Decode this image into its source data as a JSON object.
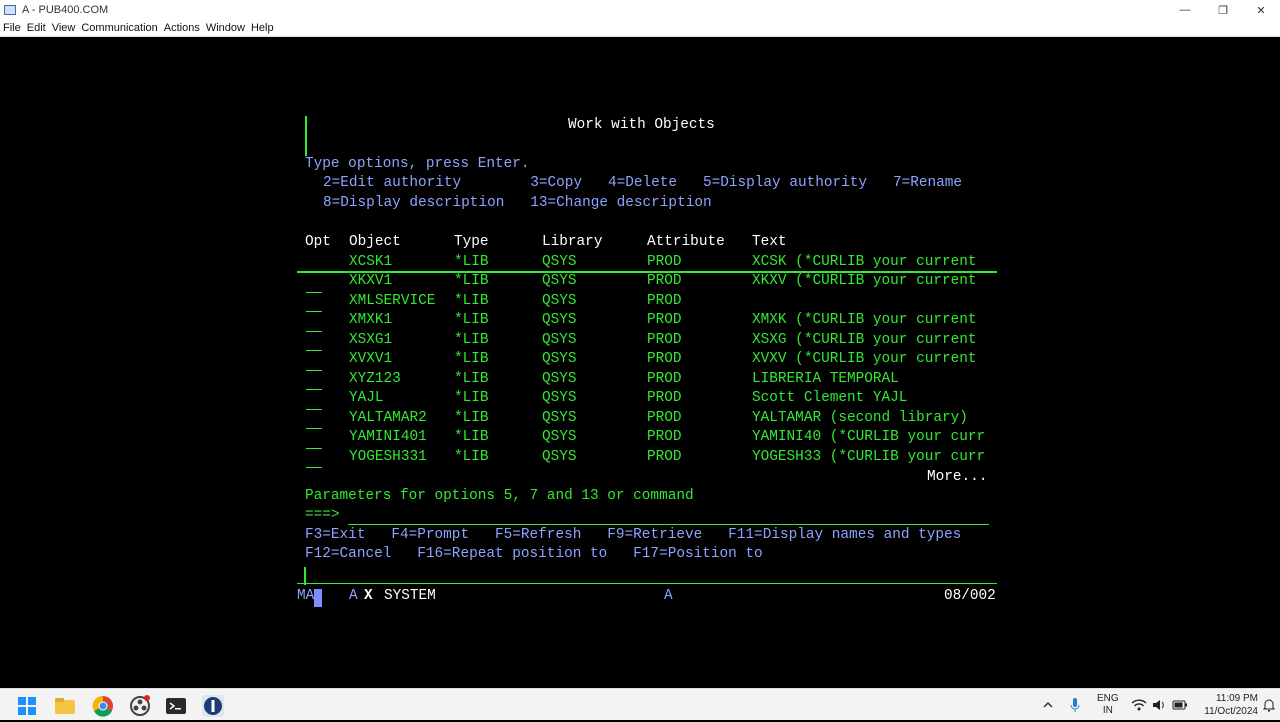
{
  "window": {
    "title": "A - PUB400.COM",
    "controls": [
      "—",
      "❐",
      "✕"
    ]
  },
  "menu": [
    "File",
    "Edit",
    "View",
    "Communication",
    "Actions",
    "Window",
    "Help"
  ],
  "screen": {
    "title": "Work with Objects",
    "instruction": "Type options, press Enter.",
    "options_line1": "2=Edit authority        3=Copy   4=Delete   5=Display authority   7=Rename",
    "options_line2": "8=Display description   13=Change description",
    "headers": {
      "opt": "Opt",
      "object": "Object",
      "type": "Type",
      "library": "Library",
      "attribute": "Attribute",
      "text": "Text"
    },
    "rows": [
      {
        "object": "XCSK1",
        "type": "*LIB",
        "library": "QSYS",
        "attribute": "PROD",
        "text": "XCSK (*CURLIB your current"
      },
      {
        "object": "XKXV1",
        "type": "*LIB",
        "library": "QSYS",
        "attribute": "PROD",
        "text": "XKXV (*CURLIB your current"
      },
      {
        "object": "XMLSERVICE",
        "type": "*LIB",
        "library": "QSYS",
        "attribute": "PROD",
        "text": ""
      },
      {
        "object": "XMXK1",
        "type": "*LIB",
        "library": "QSYS",
        "attribute": "PROD",
        "text": "XMXK (*CURLIB your current"
      },
      {
        "object": "XSXG1",
        "type": "*LIB",
        "library": "QSYS",
        "attribute": "PROD",
        "text": "XSXG (*CURLIB your current"
      },
      {
        "object": "XVXV1",
        "type": "*LIB",
        "library": "QSYS",
        "attribute": "PROD",
        "text": "XVXV (*CURLIB your current"
      },
      {
        "object": "XYZ123",
        "type": "*LIB",
        "library": "QSYS",
        "attribute": "PROD",
        "text": "LIBRERIA TEMPORAL"
      },
      {
        "object": "YAJL",
        "type": "*LIB",
        "library": "QSYS",
        "attribute": "PROD",
        "text": "Scott Clement YAJL"
      },
      {
        "object": "YALTAMAR2",
        "type": "*LIB",
        "library": "QSYS",
        "attribute": "PROD",
        "text": "YALTAMAR (second library)"
      },
      {
        "object": "YAMINI401",
        "type": "*LIB",
        "library": "QSYS",
        "attribute": "PROD",
        "text": "YAMINI40 (*CURLIB your curr"
      },
      {
        "object": "YOGESH331",
        "type": "*LIB",
        "library": "QSYS",
        "attribute": "PROD",
        "text": "YOGESH33 (*CURLIB your curr"
      }
    ],
    "more": "More...",
    "params_label": "Parameters for options 5, 7 and 13 or command",
    "prompt": "===>",
    "fkeys_line1": "F3=Exit   F4=Prompt   F5=Refresh   F9=Retrieve   F11=Display names and types",
    "fkeys_line2": "F12=Cancel   F16=Repeat position to   F17=Position to"
  },
  "status": {
    "left": "MA",
    "session": "A",
    "system_mark": "X",
    "system": "SYSTEM",
    "mid": "A",
    "position": "08/002"
  },
  "taskbar": {
    "lang_top": "ENG",
    "lang_bottom": "IN",
    "time": "11:09 PM",
    "date": "11/Oct/2024"
  },
  "colors": {
    "green": "#32e832",
    "blue": "#8ea3ff",
    "white": "#ffffff"
  }
}
